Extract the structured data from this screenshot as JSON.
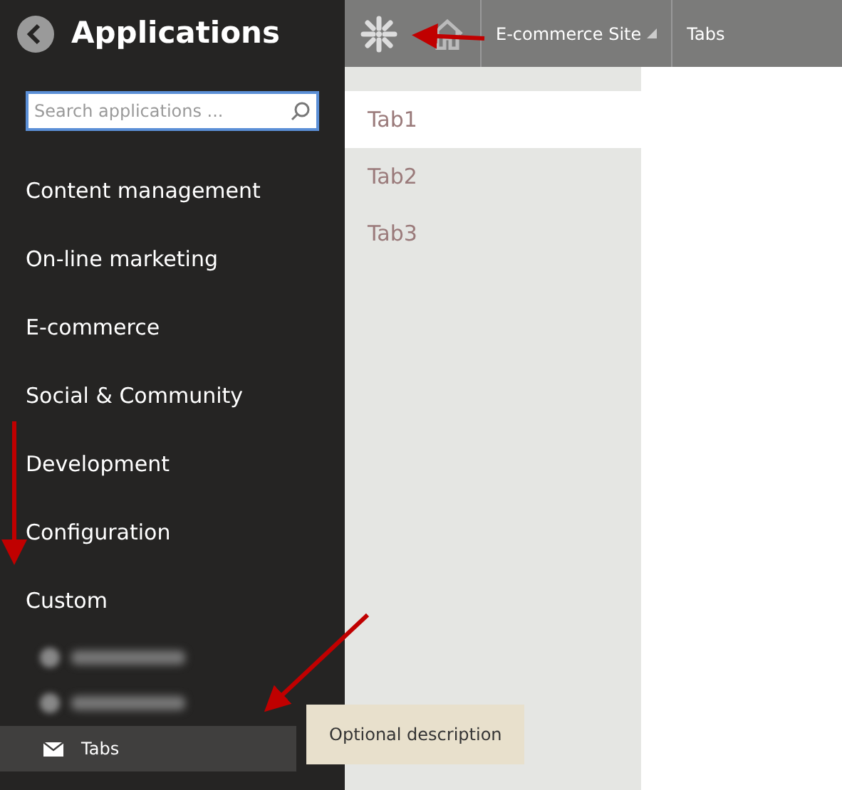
{
  "sidebar": {
    "title": "Applications",
    "search": {
      "placeholder": "Search applications ..."
    },
    "categories": [
      {
        "label": "Content management"
      },
      {
        "label": "On-line marketing"
      },
      {
        "label": "E-commerce"
      },
      {
        "label": "Social & Community"
      },
      {
        "label": "Development"
      },
      {
        "label": "Configuration"
      },
      {
        "label": "Custom",
        "children": [
          {
            "kind": "blurred",
            "selected": false
          },
          {
            "kind": "blurred",
            "selected": false
          },
          {
            "kind": "app",
            "label": "Tabs",
            "selected": true
          }
        ]
      }
    ]
  },
  "tooltip": {
    "text": "Optional description"
  },
  "header": {
    "site": "E-commerce Site",
    "breadcrumb": "Tabs"
  },
  "tabs": [
    {
      "label": "Tab1",
      "selected": true
    },
    {
      "label": "Tab2",
      "selected": false
    },
    {
      "label": "Tab3",
      "selected": false
    }
  ]
}
